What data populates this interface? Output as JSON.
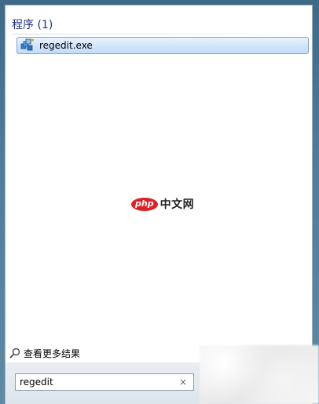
{
  "results": {
    "section_title": "程序 (1)",
    "items": [
      {
        "label": "regedit.exe",
        "icon": "regedit-icon"
      }
    ]
  },
  "watermark": {
    "badge": "php",
    "text": "中文网"
  },
  "see_more": {
    "label": "查看更多结果",
    "icon": "search-icon"
  },
  "search": {
    "value": "regedit",
    "clear_glyph": "×"
  },
  "colors": {
    "header_text": "#1e3287",
    "highlight_border": "#7da2ce",
    "highlight_bg": "#d3e6fb",
    "badge_red": "#d8232a"
  }
}
